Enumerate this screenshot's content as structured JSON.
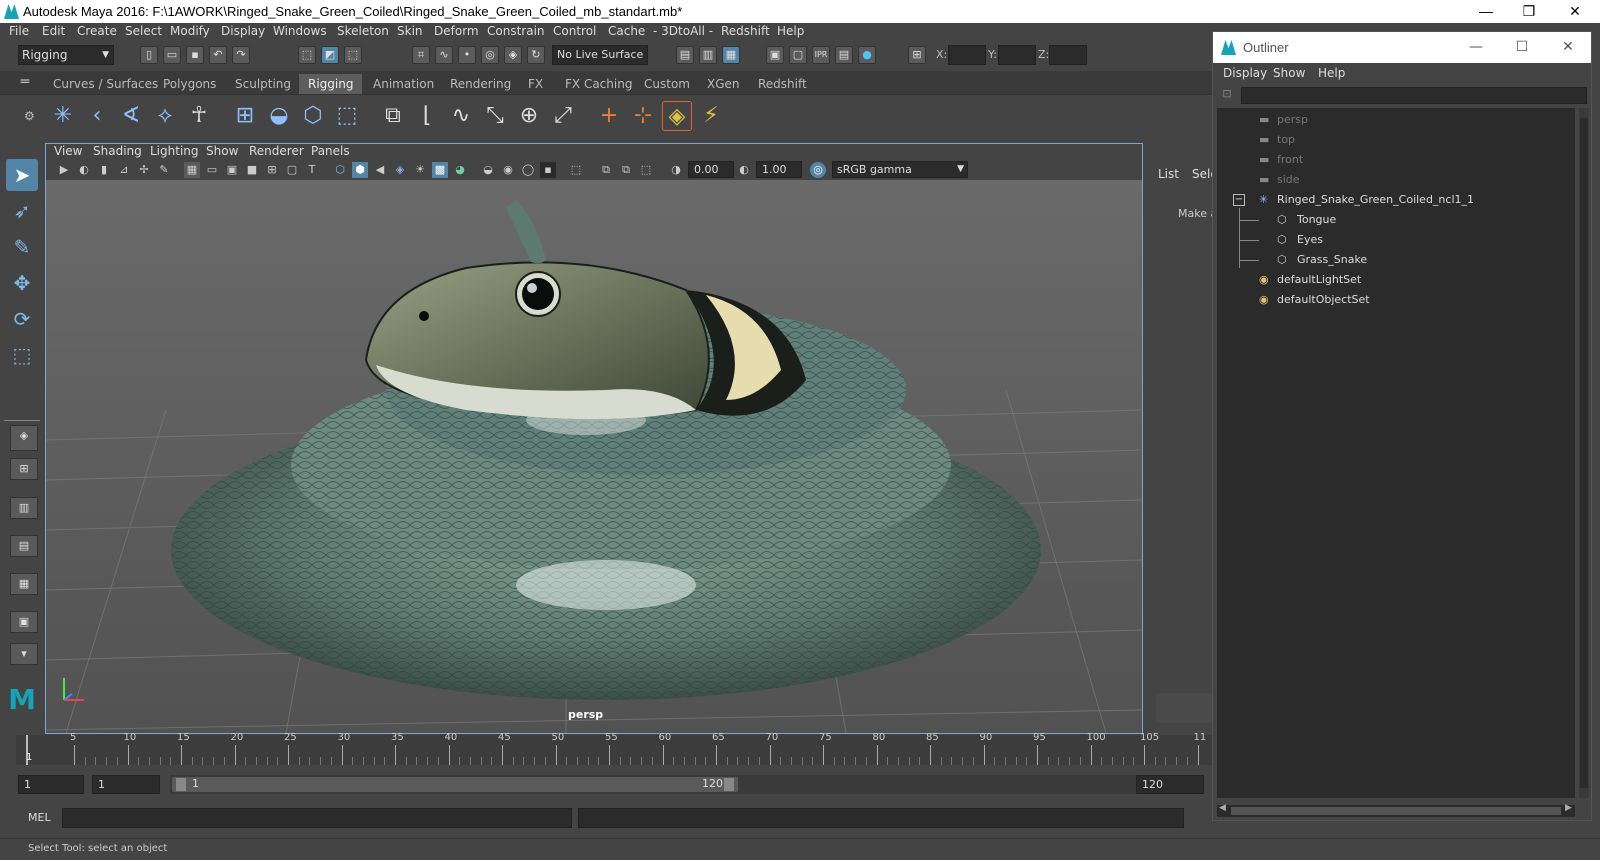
{
  "window": {
    "title": "Autodesk Maya 2016: F:\\1AWORK\\Ringed_Snake_Green_Coiled\\Ringed_Snake_Green_Coiled_mb_standart.mb*",
    "minimize": "—",
    "restore": "❐",
    "close": "✕"
  },
  "menubar": [
    "File",
    "Edit",
    "Create",
    "Select",
    "Modify",
    "Display",
    "Windows",
    "Skeleton",
    "Skin",
    "Deform",
    "Constrain",
    "Control",
    "Cache",
    "- 3DtoAll -",
    "Redshift",
    "Help"
  ],
  "statusline": {
    "mode": "Rigging",
    "live_surface": "No Live Surface",
    "x_label": "X:",
    "y_label": "Y:",
    "z_label": "Z:"
  },
  "shelf": {
    "tabs": [
      "Curves / Surfaces",
      "Polygons",
      "Sculpting",
      "Rigging",
      "Animation",
      "Rendering",
      "FX",
      "FX Caching",
      "Custom",
      "XGen",
      "Redshift"
    ],
    "active_tab": "Rigging"
  },
  "viewport": {
    "menus": [
      "View",
      "Shading",
      "Lighting",
      "Show",
      "Renderer",
      "Panels"
    ],
    "exposure": "0.00",
    "gamma_value": "1.00",
    "color_space": "sRGB gamma",
    "camera_label": "persp"
  },
  "midpanel": {
    "tab_list": "List",
    "tab_sele": "Sele",
    "make_text": "Make a"
  },
  "outliner": {
    "title": "Outliner",
    "menus": [
      "Display",
      "Show",
      "Help"
    ],
    "items": [
      {
        "label": "persp",
        "dim": true,
        "indent": 0
      },
      {
        "label": "top",
        "dim": true,
        "indent": 0
      },
      {
        "label": "front",
        "dim": true,
        "indent": 0
      },
      {
        "label": "side",
        "dim": true,
        "indent": 0
      },
      {
        "label": "Ringed_Snake_Green_Coiled_ncl1_1",
        "dim": false,
        "indent": 0
      },
      {
        "label": "Tongue",
        "dim": false,
        "indent": 1
      },
      {
        "label": "Eyes",
        "dim": false,
        "indent": 1
      },
      {
        "label": "Grass_Snake",
        "dim": false,
        "indent": 1
      },
      {
        "label": "defaultLightSet",
        "dim": false,
        "indent": 0
      },
      {
        "label": "defaultObjectSet",
        "dim": false,
        "indent": 0
      }
    ]
  },
  "timeline": {
    "ticks": [
      "5",
      "10",
      "15",
      "20",
      "25",
      "30",
      "35",
      "40",
      "45",
      "50",
      "55",
      "60",
      "65",
      "70",
      "75",
      "80",
      "85",
      "90",
      "95",
      "100",
      "105",
      "11"
    ],
    "current_frame": "1"
  },
  "range": {
    "start": "1",
    "playback_start": "1",
    "slider_start": "1",
    "slider_end": "120",
    "end": "120"
  },
  "command": {
    "label": "MEL"
  },
  "help": {
    "text": "Select Tool: select an object"
  }
}
